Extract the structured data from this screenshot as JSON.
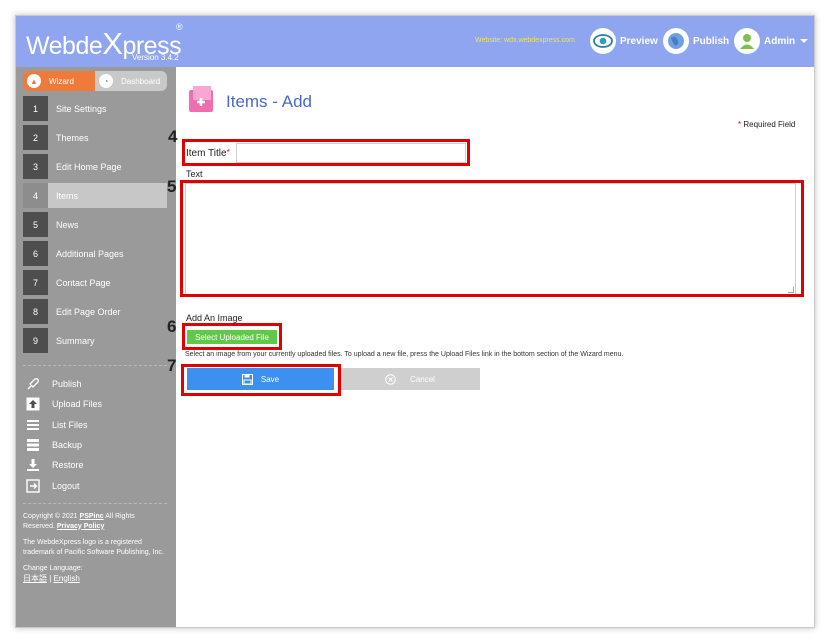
{
  "header": {
    "logo_pre": "Webde",
    "logo_x": "X",
    "logo_post": "press",
    "logo_reg": "®",
    "version": "Version 3.4.2",
    "website": "Website: wdx.webdexpress.com",
    "preview_label": "Preview",
    "publish_label": "Publish",
    "admin_label": "Admin"
  },
  "sidebar": {
    "tabs": [
      {
        "label": "Wizard"
      },
      {
        "label": "Dashboard"
      }
    ],
    "items": [
      {
        "num": "1",
        "label": "Site Settings"
      },
      {
        "num": "2",
        "label": "Themes"
      },
      {
        "num": "3",
        "label": "Edit Home Page"
      },
      {
        "num": "4",
        "label": "Items"
      },
      {
        "num": "5",
        "label": "News"
      },
      {
        "num": "6",
        "label": "Additional Pages"
      },
      {
        "num": "7",
        "label": "Contact Page"
      },
      {
        "num": "8",
        "label": "Edit Page Order"
      },
      {
        "num": "9",
        "label": "Summary"
      }
    ],
    "tools": [
      {
        "label": "Publish",
        "icon": "rocket-icon"
      },
      {
        "label": "Upload Files",
        "icon": "upload-icon"
      },
      {
        "label": "List Files",
        "icon": "list-icon"
      },
      {
        "label": "Backup",
        "icon": "backup-icon"
      },
      {
        "label": "Restore",
        "icon": "download-icon"
      },
      {
        "label": "Logout",
        "icon": "logout-icon"
      }
    ],
    "footer": {
      "copyright_pre": "Copyright © 2021 ",
      "company": "PSPinc",
      "copyright_post": " All Rights Reserved. ",
      "privacy": "Privacy Policy",
      "trademark": "The WebdeXpress logo is a registered trademark of Pacific Software Publishing, Inc.",
      "change_language": "Change Language:",
      "lang_ja": "日本語",
      "lang_sep": " | ",
      "lang_en": "English"
    }
  },
  "main": {
    "title": "Items - Add",
    "required_star": "*",
    "required_label": " Required Field",
    "item_title_label": "Item Title",
    "item_title_star": "*",
    "item_title_value": "",
    "text_label": "Text",
    "text_value": "",
    "image_label": "Add An Image",
    "select_file_button": "Select Uploaded File",
    "hint": "Select an image from your currently uploaded files. To upload a new file, press the Upload Files link in the bottom section of the Wizard menu.",
    "save_button": "Save",
    "cancel_button": "Cancel"
  },
  "annotations": [
    "4",
    "5",
    "6",
    "7"
  ],
  "colors": {
    "header_bg": "#8fa5f0",
    "sidebar_bg": "#9a9a9a",
    "accent_orange": "#f07a3a",
    "title_blue": "#4a68c9",
    "save_blue": "#3d8ff0",
    "green": "#62c84a",
    "highlight_red": "#e00000"
  }
}
